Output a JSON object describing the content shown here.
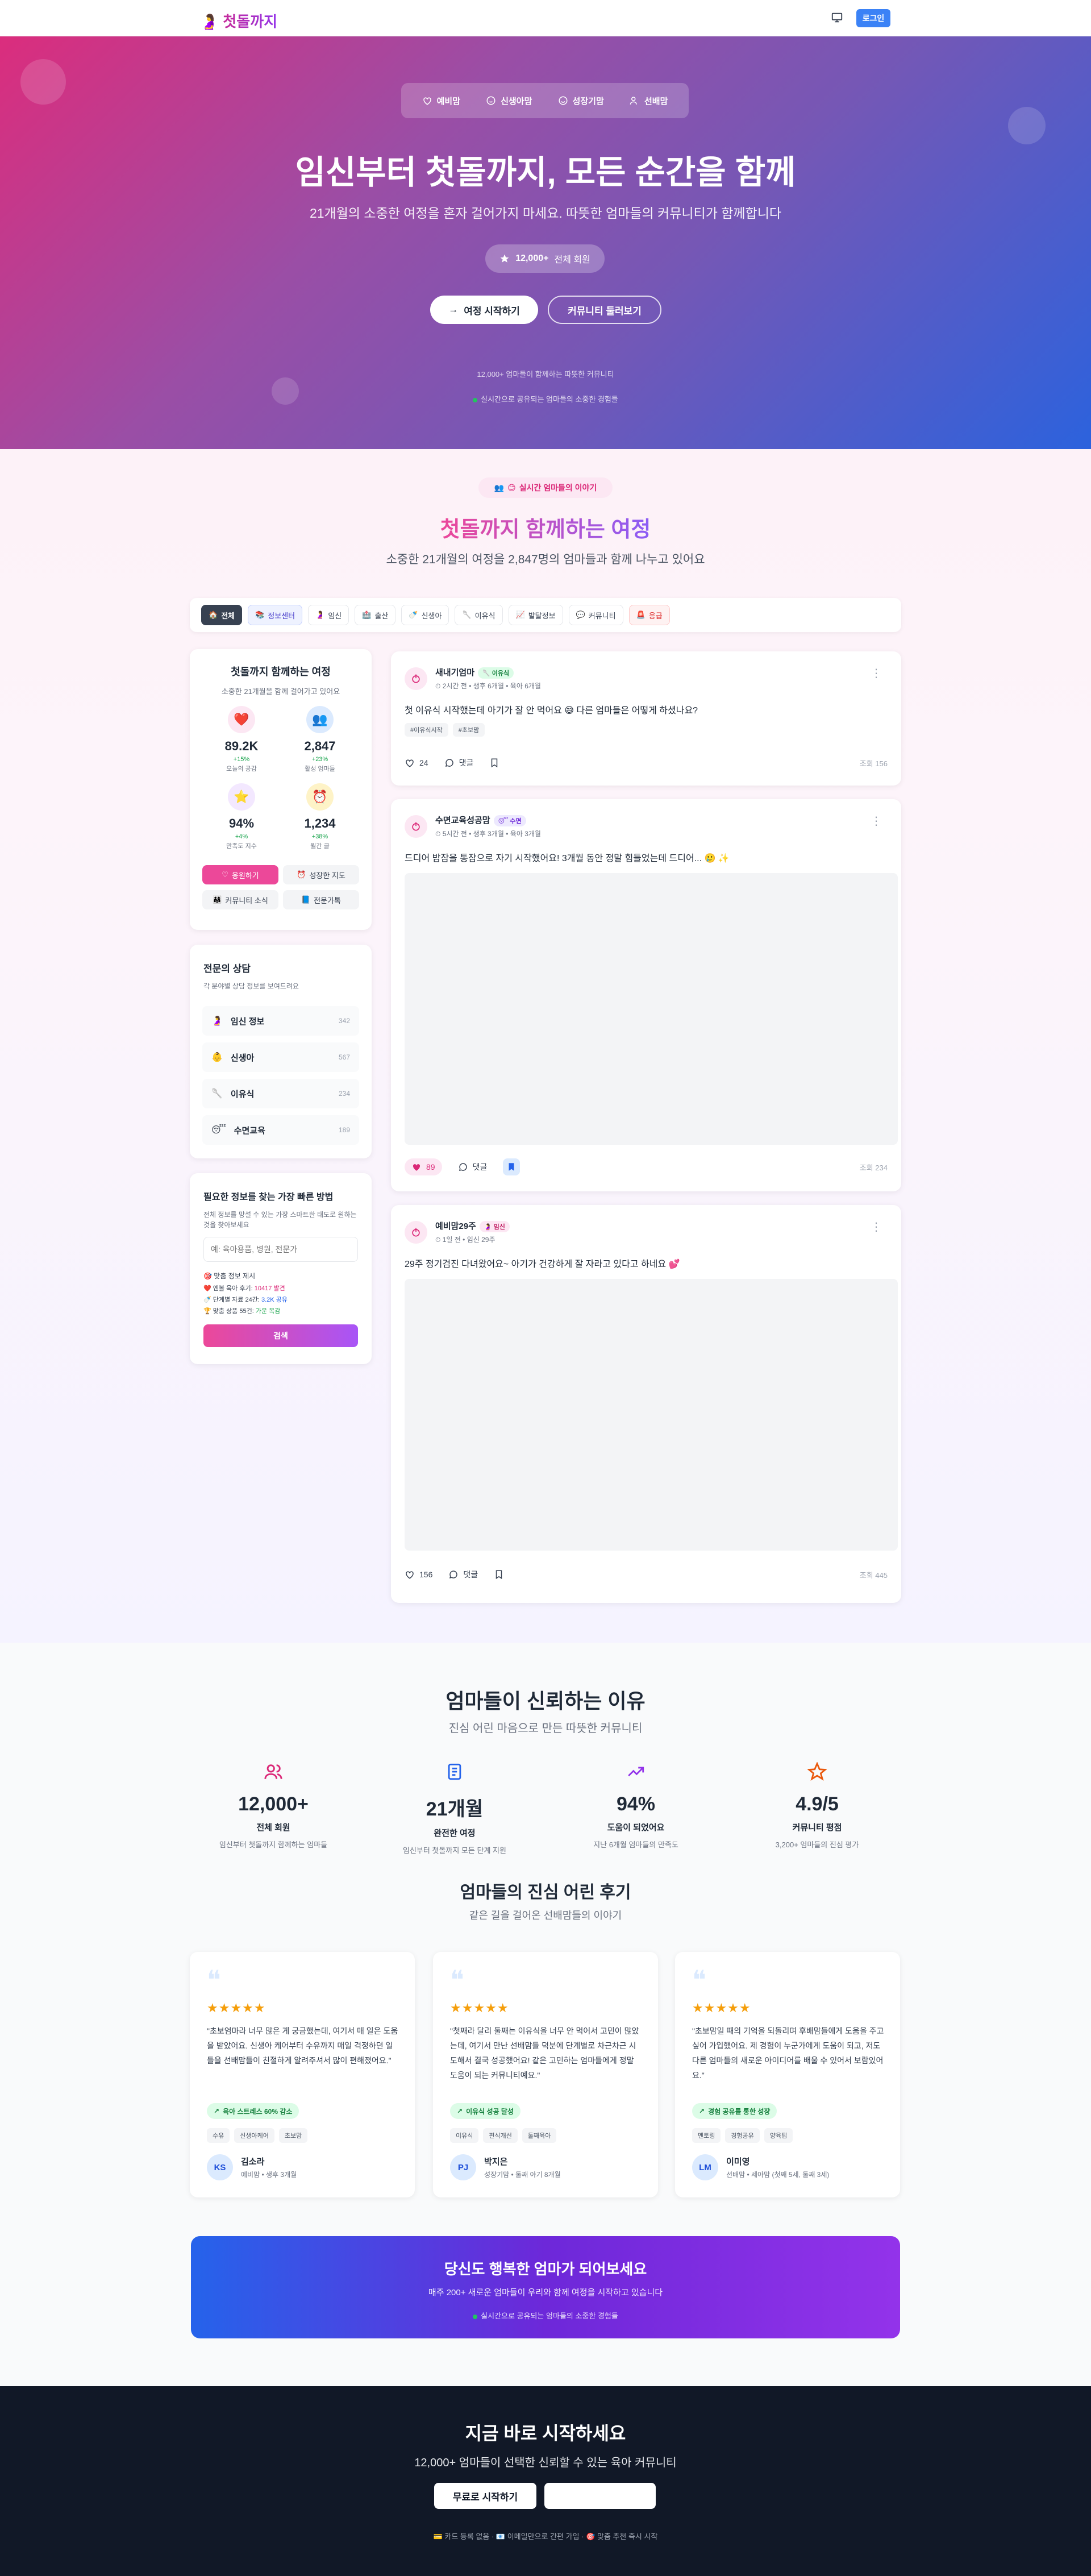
{
  "header": {
    "logo_text": "첫돌까지",
    "login_label": "로그인"
  },
  "hero": {
    "nav": [
      "예비맘",
      "신생아맘",
      "성장기맘",
      "선배맘"
    ],
    "title": "임신부터 첫돌까지, 모든 순간을 함께",
    "subtitle": "21개월의 소중한 여정을 혼자 걸어가지 마세요. 따뜻한 엄마들의 커뮤니티가 함께합니다",
    "badge_count": "12,000+",
    "badge_label": "전체 회원",
    "start_button": "여정 시작하기",
    "browse_button": "커뮤니티 둘러보기",
    "note1": "12,000+ 엄마들이 함께하는 따뜻한 커뮤니티",
    "note2": "실시간으로 공유되는 엄마들의 소중한 경험들"
  },
  "journey": {
    "badge": "실시간 엄마들의 이야기",
    "title": "첫돌까지 함께하는 여정",
    "subtitle": "소중한 21개월의 여정을 2,847명의 엄마들과 함께 나누고 있어요",
    "categories": [
      {
        "icon": "🏠",
        "label": "전체"
      },
      {
        "icon": "📚",
        "label": "정보센터"
      },
      {
        "icon": "🤰",
        "label": "임신"
      },
      {
        "icon": "🏥",
        "label": "출산"
      },
      {
        "icon": "🍼",
        "label": "신생아"
      },
      {
        "icon": "🥄",
        "label": "이유식"
      },
      {
        "icon": "📈",
        "label": "발달정보"
      },
      {
        "icon": "💬",
        "label": "커뮤니티"
      },
      {
        "icon": "🚨",
        "label": "응급"
      }
    ]
  },
  "sidebar": {
    "title": "첫돌까지 함께하는 여정",
    "subtitle": "소중한 21개월을 함께 걸어가고 있어요",
    "stats": [
      {
        "icon": "❤️",
        "value": "89.2K",
        "change": "+15%",
        "label": "오늘의 공감"
      },
      {
        "icon": "👥",
        "value": "2,847",
        "change": "+23%",
        "label": "활성 엄마들"
      },
      {
        "icon": "⭐",
        "value": "94%",
        "change": "+4%",
        "label": "만족도 지수"
      },
      {
        "icon": "⏰",
        "value": "1,234",
        "change": "+38%",
        "label": "월간 글"
      }
    ],
    "buttons": [
      "응원하기",
      "성장한 지도",
      "커뮤니티 소식",
      "전문가톡"
    ],
    "expert_title": "전문의 상담",
    "expert_sub": "각 분야별 상담 정보를 보여드려요",
    "experts": [
      {
        "icon": "🤰",
        "label": "임신 정보",
        "count": "342"
      },
      {
        "icon": "👶",
        "label": "신생아",
        "count": "567"
      },
      {
        "icon": "🥄",
        "label": "이유식",
        "count": "234"
      },
      {
        "icon": "😴",
        "label": "수면교육",
        "count": "189"
      }
    ],
    "search_title": "필요한 정보를 찾는 가장 빠른 방법",
    "search_desc": "전체 정보를 망설 수 있는 가장 스마트한 태도로 원하는 것을 찾아보세요",
    "search_placeholder": "예: 육아용품, 병원, 전문가",
    "search_hint": "🎯 맞춤 정보 제시",
    "search_items": [
      {
        "icon": "❤️",
        "text": "엔볼 육아 후기: ",
        "hl": "10417 발견"
      },
      {
        "icon": "🍼",
        "text": "단계별 자료 24간: ",
        "hl": "3.2K 공유"
      },
      {
        "icon": "🏆",
        "text": "맞춤 상품 55건: ",
        "hl": "가운 목감"
      }
    ],
    "search_button": "검색"
  },
  "posts": [
    {
      "name": "새내기엄마",
      "tag": "이유식",
      "time": "2시간 전",
      "stage": "생후 6개월",
      "sub": "육아 6개월",
      "text": "첫 이유식 시작했는데 아기가 잘 안 먹어요 😅 다른 엄마들은 어떻게 하셨나요?",
      "tags": [
        "#이유식시작",
        "#초보맘"
      ],
      "likes": "24",
      "comment_label": "댓글",
      "views": "조회 156"
    },
    {
      "name": "수면교육성공맘",
      "tag": "수면",
      "time": "5시간 전",
      "stage": "생후 3개월",
      "sub": "육아 3개월",
      "text": "드디어 밤잠을 통잠으로 자기 시작했어요! 3개월 동안 정말 힘들었는데 드디어... 🥲 ✨",
      "likes": "89",
      "comment_label": "댓글",
      "views": "조회 234"
    },
    {
      "name": "예비맘29주",
      "tag": "임신",
      "time": "1일 전",
      "stage": "임신 29주",
      "text": "29주 정기검진 다녀왔어요~ 아기가 건강하게 잘 자라고 있다고 하네요 💕",
      "likes": "156",
      "comment_label": "댓글",
      "views": "조회 445"
    }
  ],
  "trust": {
    "title": "엄마들이 신뢰하는 이유",
    "subtitle": "진심 어린 마음으로 만든 따뜻한 커뮤니티",
    "stats": [
      {
        "value": "12,000+",
        "label": "전체 회원",
        "desc": "임신부터 첫돌까지 함께하는 엄마들"
      },
      {
        "value": "21개월",
        "label": "완전한 여정",
        "desc": "임신부터 첫돌까지 모든 단계 지원"
      },
      {
        "value": "94%",
        "label": "도움이 되었어요",
        "desc": "지난 6개월 엄마들의 만족도"
      },
      {
        "value": "4.9/5",
        "label": "커뮤니티 평점",
        "desc": "3,200+ 엄마들의 진심 평가"
      }
    ],
    "review_title": "엄마들의 진심 어린 후기",
    "review_subtitle": "같은 길을 걸어온 선배맘들의 이야기",
    "reviews": [
      {
        "text": "\"초보엄마라 너무 많은 게 궁금했는데, 여기서 매 일은 도움을 받았어요. 신생아 케어부터 수유까지 매일 걱정하던 일들을 선배맘들이 친절하게 알려주셔서 많이 편해졌어요.\"",
        "badge": "육아 스트레스 60% 감소",
        "tags": [
          "수유",
          "신생아케어",
          "초보맘"
        ],
        "initials": "KS",
        "name": "김소라",
        "role": "예비맘 • 생후 3개월"
      },
      {
        "text": "\"첫째라 달리 둘째는 이유식을 너무 안 먹어서 고민이 많았는데, 여기서 만난 선배맘들 덕분에 단계별로 차근차근 시도해서 결국 성공했어요! 같은 고민하는 엄마들에게 정말 도움이 되는 커뮤니티예요.\"",
        "badge": "이유식 성공 달성",
        "tags": [
          "이유식",
          "편식개선",
          "둘째육아"
        ],
        "initials": "PJ",
        "name": "박지은",
        "role": "성장기맘 • 둘째 아기 8개월"
      },
      {
        "text": "\"초보맘일 때의 기억을 되돌리며 후배맘들에게 도움을 주고 싶어 가입했어요. 제 경험이 누군가에게 도움이 되고, 저도 다른 엄마들의 새로운 아이디어를 배울 수 있어서 보람있어요.\"",
        "badge": "경험 공유를 통한 성장",
        "tags": [
          "멘토링",
          "경험공유",
          "양육팁"
        ],
        "initials": "LM",
        "name": "이미영",
        "role": "선배맘 • 세아맘 (첫째 5세, 둘째 3세)"
      }
    ]
  },
  "cta": {
    "title": "당신도 행복한 엄마가 되어보세요",
    "subtitle": "매주 200+ 새로운 엄마들이 우리와 함께 여정을 시작하고 있습니다",
    "note": "실시간으로 공유되는 엄마들의 소중한 경험들"
  },
  "footer": {
    "title": "지금 바로 시작하세요",
    "subtitle": "12,000+ 엄마들이 선택한 신뢰할 수 있는 육아 커뮤니티",
    "button": "무료로 시작하기",
    "notes": "💳 카드 등록 없음 · 📧 이메일만으로 간편 가입 · 🎯 맞춤 추천 즉시 시작"
  }
}
